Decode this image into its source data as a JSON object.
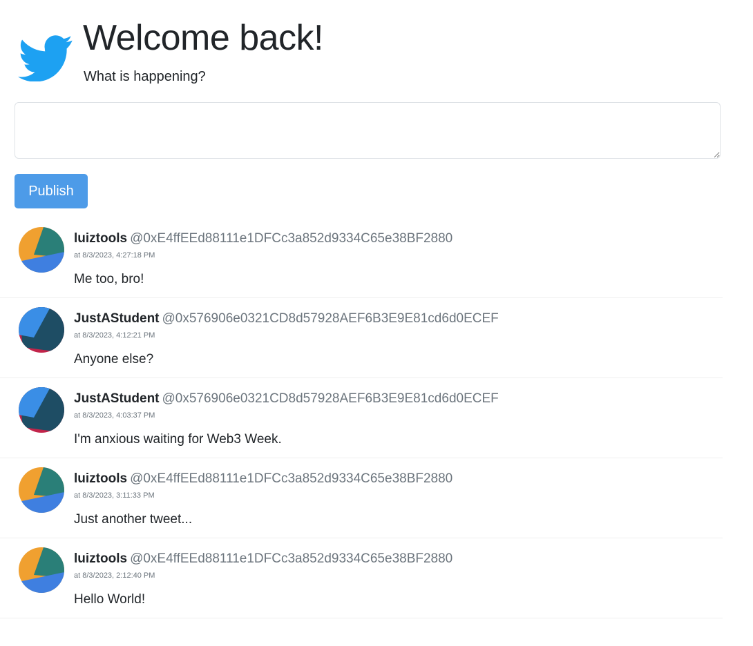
{
  "header": {
    "title": "Welcome back!",
    "subtitle": "What is happening?",
    "logo_icon": "twitter-bird-icon",
    "logo_color": "#1da1f2"
  },
  "composer": {
    "value": "",
    "placeholder": ""
  },
  "publish": {
    "label": "Publish",
    "color": "#4d9be8"
  },
  "tweets": [
    {
      "username": "luiztools",
      "address": "@0xE4ffEEd88111e1DFCc3a852d9334C65e38BF2880",
      "timestamp": "at 8/3/2023, 4:27:18 PM",
      "text": "Me too, bro!",
      "avatar": "identicon-orange-teal-blue"
    },
    {
      "username": "JustAStudent",
      "address": "@0x576906e0321CD8d57928AEF6B3E9E81cd6d0ECEF",
      "timestamp": "at 8/3/2023, 4:12:21 PM",
      "text": "Anyone else?",
      "avatar": "identicon-navy-blue-red"
    },
    {
      "username": "JustAStudent",
      "address": "@0x576906e0321CD8d57928AEF6B3E9E81cd6d0ECEF",
      "timestamp": "at 8/3/2023, 4:03:37 PM",
      "text": "I'm anxious waiting for Web3 Week.",
      "avatar": "identicon-navy-blue-red"
    },
    {
      "username": "luiztools",
      "address": "@0xE4ffEEd88111e1DFCc3a852d9334C65e38BF2880",
      "timestamp": "at 8/3/2023, 3:11:33 PM",
      "text": "Just another tweet...",
      "avatar": "identicon-orange-teal-blue"
    },
    {
      "username": "luiztools",
      "address": "@0xE4ffEEd88111e1DFCc3a852d9334C65e38BF2880",
      "timestamp": "at 8/3/2023, 2:12:40 PM",
      "text": "Hello World!",
      "avatar": "identicon-orange-teal-blue"
    }
  ]
}
